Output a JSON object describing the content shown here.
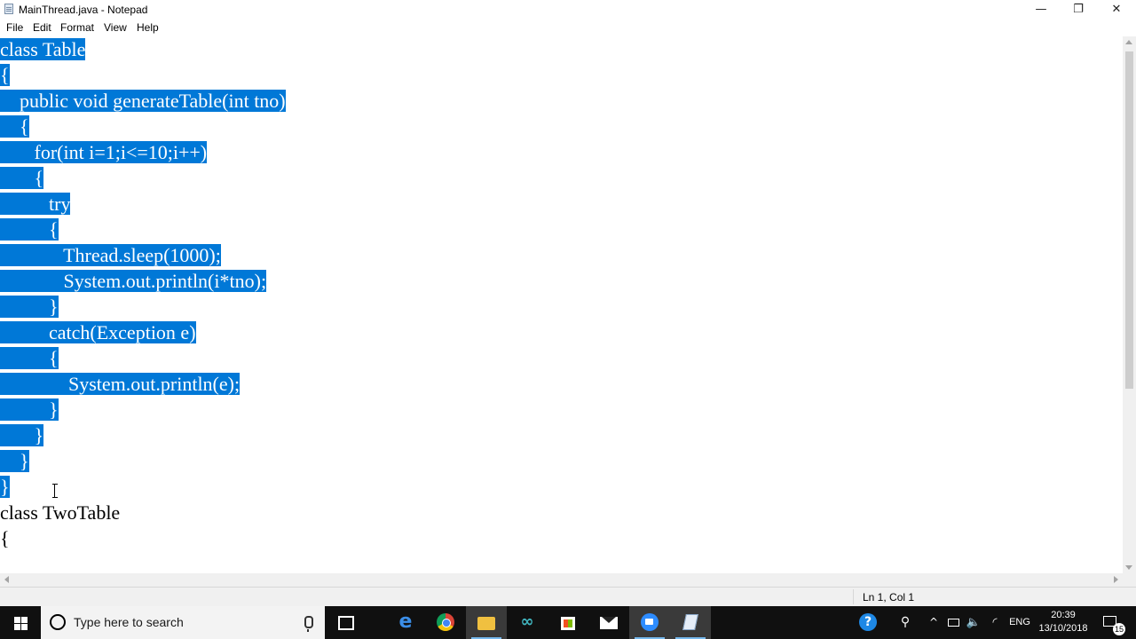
{
  "window": {
    "title": "MainThread.java - Notepad",
    "minimize_glyph": "—",
    "maximize_glyph": "❐",
    "close_glyph": "✕"
  },
  "menu": {
    "file": "File",
    "edit": "Edit",
    "format": "Format",
    "view": "View",
    "help": "Help"
  },
  "editor": {
    "selection_color": "#0078d7",
    "lines": [
      "class Table",
      "{",
      "    public void generateTable(int tno)",
      "    {",
      "       for(int i=1;i<=10;i++)",
      "       {",
      "          try",
      "          {",
      "             Thread.sleep(1000);",
      "             System.out.println(i*tno);",
      "          }",
      "          catch(Exception e)",
      "          {",
      "              System.out.println(e);",
      "          }",
      "       }",
      "    }",
      "}",
      "class TwoTable",
      "{"
    ]
  },
  "status": {
    "position": "Ln 1, Col 1"
  },
  "taskbar": {
    "search_placeholder": "Type here to search",
    "edge_glyph": "e",
    "arduino_glyph": "∞",
    "help_glyph": "?",
    "people_glyph": "⚲",
    "chevron_glyph": "^",
    "volume_glyph": "🔈",
    "wifi_glyph": "◜",
    "language": "ENG",
    "time": "20:39",
    "date": "13/10/2018",
    "notification_count": "15",
    "accent_color": "#76b9ed"
  }
}
